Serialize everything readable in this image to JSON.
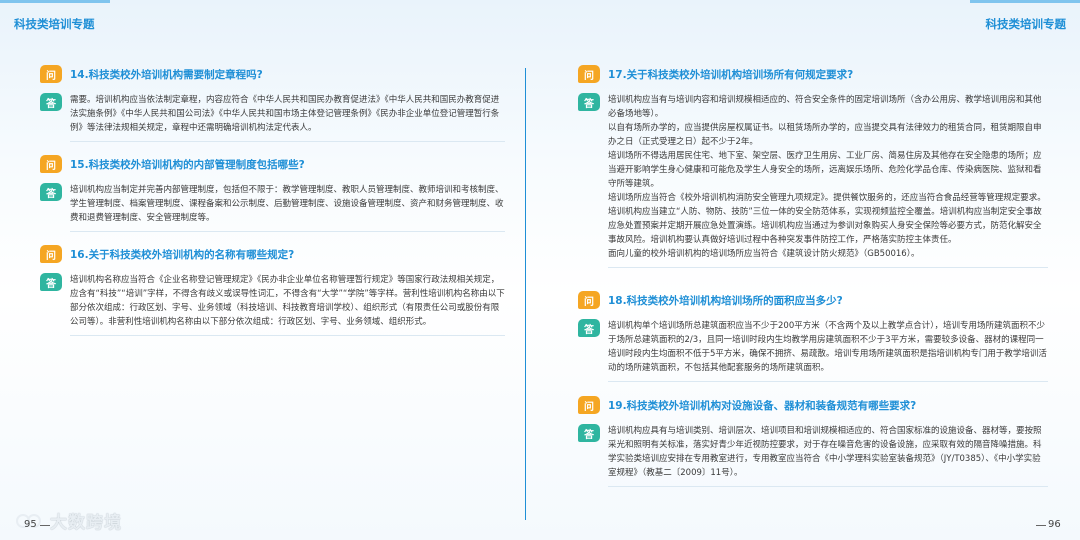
{
  "header": {
    "left_title": "科技类培训专题",
    "right_title": "科技类培训专题"
  },
  "labels": {
    "q": "问",
    "a": "答"
  },
  "pages": {
    "left_number": "95",
    "right_number": "96"
  },
  "watermark": "大数跨境",
  "left_items": [
    {
      "question": "14.科技类校外培训机构需要制定章程吗?",
      "answer": [
        "需要。培训机构应当依法制定章程，内容应符合《中华人民共和国民办教育促进法》《中华人民共和国民办教育促进法实施条例》《中华人民共和国公司法》《中华人民共和国市场主体登记管理条例》《民办非企业单位登记管理暂行条例》等法律法规相关规定，章程中还需明确培训机构法定代表人。"
      ]
    },
    {
      "question": "15.科技类校外培训机构的内部管理制度包括哪些?",
      "answer": [
        "培训机构应当制定并完善内部管理制度，包括但不限于：教学管理制度、教职人员管理制度、教师培训和考核制度、学生管理制度、档案管理制度、课程备案和公示制度、后勤管理制度、设施设备管理制度、资产和财务管理制度、收费和退费管理制度、安全管理制度等。"
      ]
    },
    {
      "question": "16.关于科技类校外培训机构的名称有哪些规定?",
      "answer": [
        "培训机构名称应当符合《企业名称登记管理规定》《民办非企业单位名称管理暂行规定》等国家行政法规相关规定，应含有“科技”“培训”字样，不得含有歧义或误导性词汇，不得含有“大学”“学院”等字样。营利性培训机构名称由以下部分依次组成：行政区划、字号、业务领域（科技培训、科技教育培训学校）、组织形式（有限责任公司或股份有限公司等）。非营利性培训机构名称由以下部分依次组成：行政区划、字号、业务领域、组织形式。"
      ]
    }
  ],
  "right_items": [
    {
      "question": "17.关于科技类校外培训机构培训场所有何规定要求?",
      "answer": [
        "培训机构应当有与培训内容和培训规模相适应的、符合安全条件的固定培训场所（含办公用房、教学培训用房和其他必备场地等）。",
        "以自有场所办学的，应当提供房屋权属证书。以租赁场所办学的，应当提交具有法律效力的租赁合同，租赁期限自申办之日（正式受理之日）起不少于2年。",
        "培训场所不得选用居民住宅、地下室、架空层、医疗卫生用房、工业厂房、简易住房及其他存在安全隐患的场所；应当避开影响学生身心健康和可能危及学生人身安全的场所，远离娱乐场所、危险化学品仓库、传染病医院、监狱和看守所等建筑。",
        "培训场所应当符合《校外培训机构消防安全管理九项规定》。提供餐饮服务的，还应当符合食品经营等管理规定要求。培训机构应当建立“人防、物防、技防”三位一体的安全防范体系，实现视频监控全覆盖。培训机构应当制定安全事故应急处置预案并定期开展应急处置演练。培训机构应当通过为参训对象购买人身安全保险等必要方式，防范化解安全事故风险。培训机构要认真做好培训过程中各种突发事件防控工作，严格落实防控主体责任。",
        "面向儿童的校外培训机构的培训场所应当符合《建筑设计防火规范》（GB50016）。"
      ]
    },
    {
      "question": "18.科技类校外培训机构培训场所的面积应当多少?",
      "answer": [
        "培训机构单个培训场所总建筑面积应当不少于200平方米（不含两个及以上教学点合计），培训专用场所建筑面积不少于场所总建筑面积的2/3，且同一培训时段内生均教学用房建筑面积不少于3平方米，需要较多设备、器材的课程同一培训时段内生均面积不低于5平方米，确保不拥挤、易疏散。培训专用场所建筑面积是指培训机构专门用于教学培训活动的场所建筑面积，不包括其他配套服务的场所建筑面积。"
      ]
    },
    {
      "question": "19.科技类校外培训机构对设施设备、器材和装备规范有哪些要求?",
      "answer": [
        "培训机构应具有与培训类别、培训层次、培训项目和培训规模相适应的、符合国家标准的设施设备、器材等，要按照采光和照明有关标准，落实好青少年近视防控要求，对于存在噪音危害的设备设施，应采取有效的隔音降噪措施。科学实验类培训应安排在专用教室进行，专用教室应当符合《中小学理科实验室装备规范》（JY/T0385）、《中小学实验室规程》（教基二〔2009〕11号）。"
      ]
    }
  ]
}
